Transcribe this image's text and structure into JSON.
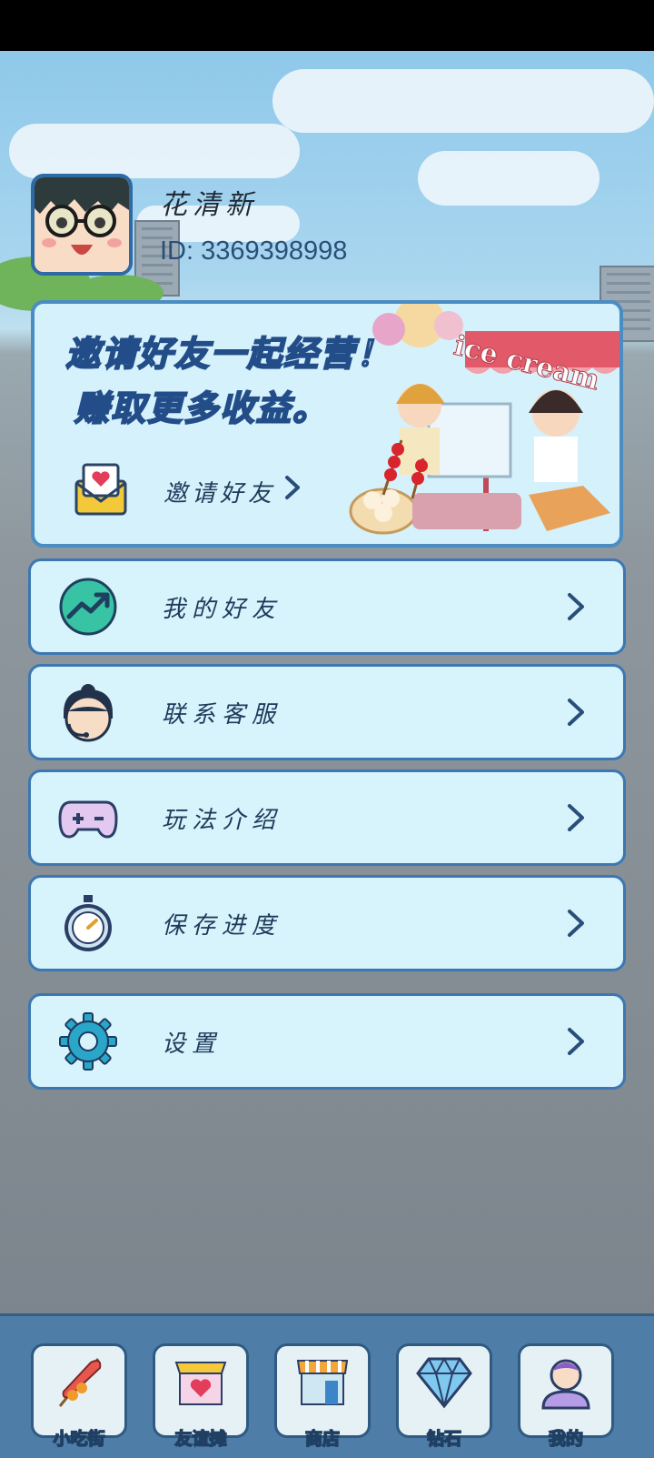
{
  "profile": {
    "name": "花清新",
    "id_text": "ID: 3369398998"
  },
  "banner": {
    "headline": "邀请好友一起经营！",
    "subline": "赚取更多收益。",
    "invite_label": "邀请好友",
    "illustration_text": "ice cream"
  },
  "menu": {
    "items": [
      {
        "label": "我的好友",
        "icon": "trend-up-icon"
      },
      {
        "label": "联系客服",
        "icon": "customer-service-icon"
      },
      {
        "label": "玩法介绍",
        "icon": "gamepad-icon"
      },
      {
        "label": "保存进度",
        "icon": "stopwatch-icon"
      },
      {
        "label": "设置",
        "icon": "gear-icon"
      }
    ]
  },
  "nav": {
    "items": [
      {
        "label": "小吃街",
        "icon": "skewer-icon"
      },
      {
        "label": "友谊摊",
        "icon": "heart-stall-icon"
      },
      {
        "label": "商店",
        "icon": "shop-icon"
      },
      {
        "label": "钻石",
        "icon": "diamond-icon"
      },
      {
        "label": "我的",
        "icon": "profile-icon"
      }
    ]
  },
  "colors": {
    "card_bg": "#d7f3fc",
    "card_border": "#3c77b2",
    "nav_bg": "#4e7ea8",
    "accent_yellow": "#f6c436"
  }
}
